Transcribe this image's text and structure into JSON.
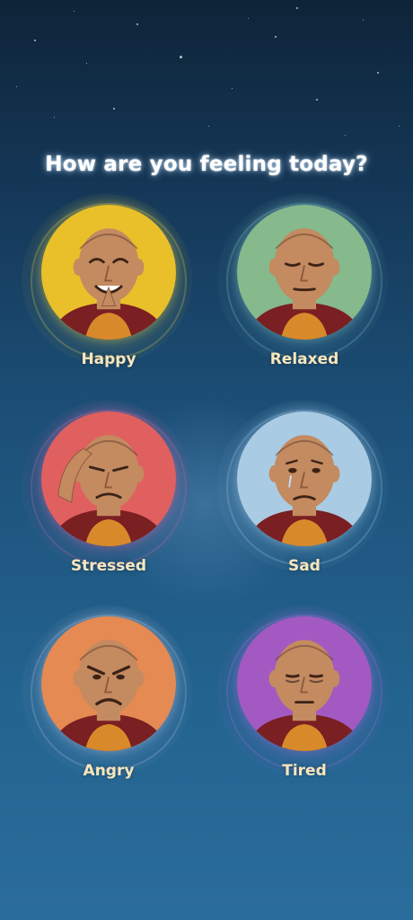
{
  "title": "How are you feeling today?",
  "moods": [
    {
      "label": "Happy",
      "bg": "#e9c02a",
      "glow": "#d9c94a"
    },
    {
      "label": "Relaxed",
      "bg": "#86b98c",
      "glow": "#7fbfc0"
    },
    {
      "label": "Stressed",
      "bg": "#e0605f",
      "glow": "#c06aa8"
    },
    {
      "label": "Sad",
      "bg": "#a9cbe3",
      "glow": "#9fc7e6"
    },
    {
      "label": "Angry",
      "bg": "#e48a52",
      "glow": "#a9b8d8"
    },
    {
      "label": "Tired",
      "bg": "#a25ac2",
      "glow": "#9b6fd3"
    }
  ],
  "colors": {
    "bg_top": "#0e2438",
    "bg_bottom": "#2a6c9b",
    "robe": "#7a1f22",
    "robe_inner": "#d88a2a",
    "skin": "#c48a60",
    "label": "#f7e6bd"
  }
}
